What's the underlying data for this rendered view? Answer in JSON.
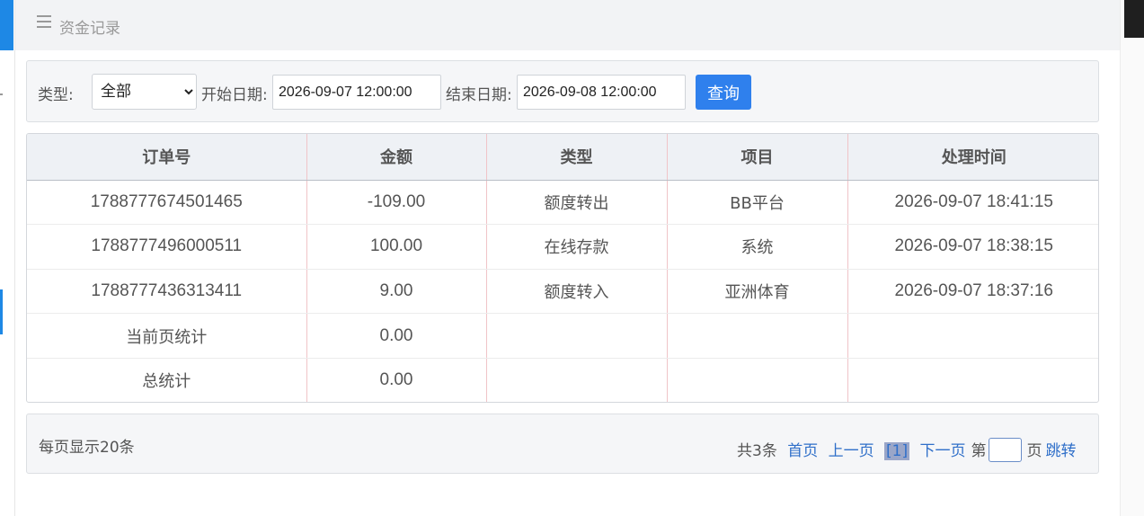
{
  "header": {
    "title": "资金记录"
  },
  "filter": {
    "type_label": "类型:",
    "type_value": "全部",
    "start_label": "开始日期:",
    "start_value": "2026-09-07 12:00:00",
    "end_label": "结束日期:",
    "end_value": "2026-09-08 12:00:00",
    "query_label": "查询"
  },
  "table": {
    "headers": [
      "订单号",
      "金额",
      "类型",
      "项目",
      "处理时间"
    ],
    "rows": [
      [
        "1788777674501465",
        "-109.00",
        "额度转出",
        "BB平台",
        "2026-09-07 18:41:15"
      ],
      [
        "1788777496000511",
        "100.00",
        "在线存款",
        "系统",
        "2026-09-07 18:38:15"
      ],
      [
        "1788777436313411",
        "9.00",
        "额度转入",
        "亚洲体育",
        "2026-09-07 18:37:16"
      ],
      [
        "当前页统计",
        "0.00",
        "",
        "",
        ""
      ],
      [
        "总统计",
        "0.00",
        "",
        "",
        ""
      ]
    ]
  },
  "pager": {
    "per_page": "每页显示20条",
    "total": "共3条",
    "first": "首页",
    "prev": "上一页",
    "current": "[1]",
    "next": "下一页",
    "page_prefix": "第",
    "page_suffix": "页",
    "jump": "跳转"
  }
}
